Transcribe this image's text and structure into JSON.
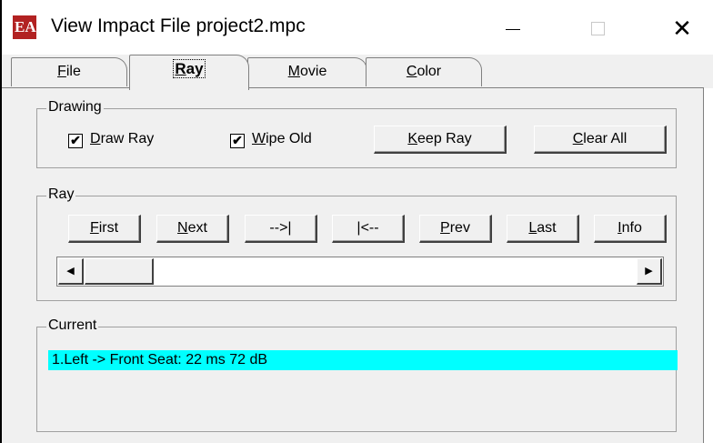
{
  "window": {
    "title": "View Impact File project2.mpc",
    "app_icon_text": "EA",
    "controls": {
      "minimize": "—",
      "maximize": "☐",
      "close": "✕"
    }
  },
  "tabs": [
    {
      "label": "File",
      "accel": "F",
      "rest": "ile",
      "active": false
    },
    {
      "label": "Ray",
      "accel": "R",
      "rest": "ay",
      "active": true
    },
    {
      "label": "Movie",
      "accel": "M",
      "rest": "ovie",
      "active": false
    },
    {
      "label": "Color",
      "accel": "C",
      "rest": "olor",
      "active": false
    }
  ],
  "drawing": {
    "title": "Drawing",
    "draw_ray": {
      "accel": "D",
      "rest": "raw Ray",
      "checked": true,
      "mark": "✔"
    },
    "wipe_old": {
      "accel": "W",
      "rest": "ipe Old",
      "checked": true,
      "mark": "✔"
    },
    "keep_ray": {
      "accel": "K",
      "rest": "eep Ray"
    },
    "clear_all": {
      "accel": "C",
      "rest": "lear All"
    }
  },
  "ray": {
    "title": "Ray",
    "buttons": {
      "first": {
        "accel": "F",
        "rest": "irst"
      },
      "next": {
        "accel": "N",
        "rest": "ext"
      },
      "fwd": {
        "accel": "",
        "rest": "-->|"
      },
      "back": {
        "accel": "",
        "rest": "|<--"
      },
      "prev": {
        "accel": "P",
        "rest": "rev"
      },
      "last": {
        "accel": "L",
        "rest": "ast"
      },
      "info": {
        "accel": "I",
        "rest": "nfo"
      }
    },
    "scroll": {
      "left_arrow": "◀",
      "right_arrow": "▶",
      "position": 0
    }
  },
  "current": {
    "title": "Current",
    "selected_item": "1.Left -> Front Seat: 22 ms 72 dB",
    "highlight_color": "#00ffff"
  }
}
